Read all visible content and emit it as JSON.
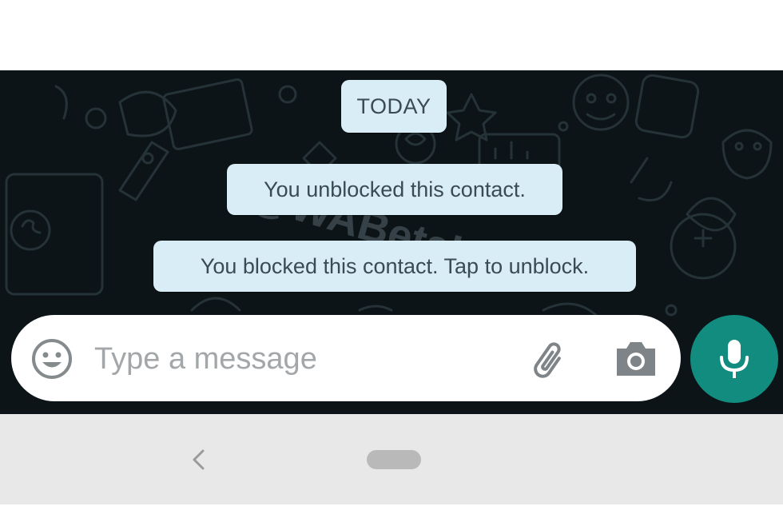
{
  "chat": {
    "date_label": "TODAY",
    "system_messages": [
      "You unblocked this contact.",
      "You blocked this contact. Tap to unblock."
    ],
    "watermark": "@WABetaInfo"
  },
  "composer": {
    "placeholder": "Type a message",
    "emoji_icon": "emoji-icon",
    "attach_icon": "paperclip-icon",
    "camera_icon": "camera-icon",
    "mic_icon": "microphone-icon"
  },
  "navigation": {
    "back_icon": "chevron-left-icon",
    "home_icon": "home-pill-icon"
  },
  "colors": {
    "chat_background": "#0c1417",
    "system_bubble": "#d9edf7",
    "accent": "#128c7e",
    "nav_bar": "#e8e8e8"
  }
}
